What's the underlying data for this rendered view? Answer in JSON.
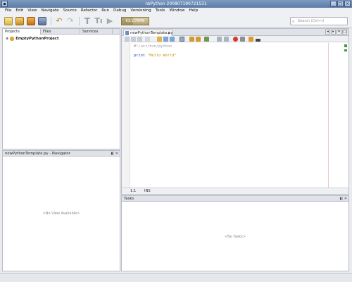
{
  "window": {
    "title": "nbPython 200807190721531"
  },
  "menu": [
    "File",
    "Edit",
    "View",
    "Navigate",
    "Source",
    "Refactor",
    "Run",
    "Debug",
    "Versioning",
    "Tools",
    "Window",
    "Help"
  ],
  "toolbar": {
    "memory_label": "63.1/76MB",
    "memory_used_fraction": 0.42,
    "search_placeholder": "Search (Ctrl+I)"
  },
  "projects_panel": {
    "tabs": [
      "Projects",
      "Files",
      "Services"
    ],
    "tree": [
      {
        "label": "EmptyPythonProject",
        "expander": "⊕"
      }
    ]
  },
  "navigator": {
    "title": "newPythonTemplate.py - Navigator",
    "empty_text": "<No View Available>"
  },
  "editor": {
    "tab_label": "newPythonTemplate.py",
    "lines": [
      {
        "text": "#!/usr/bin/python"
      },
      {
        "keyword": "print",
        "string": "\"Hello World\""
      }
    ],
    "status": {
      "position": "1:1",
      "mode": "INS"
    }
  },
  "tasks": {
    "title": "Tasks",
    "empty_text": "<No Tasks>"
  },
  "colors": {
    "title_bar": "#5b79a6",
    "keyword": "#1b33c2",
    "string": "#c28a00"
  }
}
